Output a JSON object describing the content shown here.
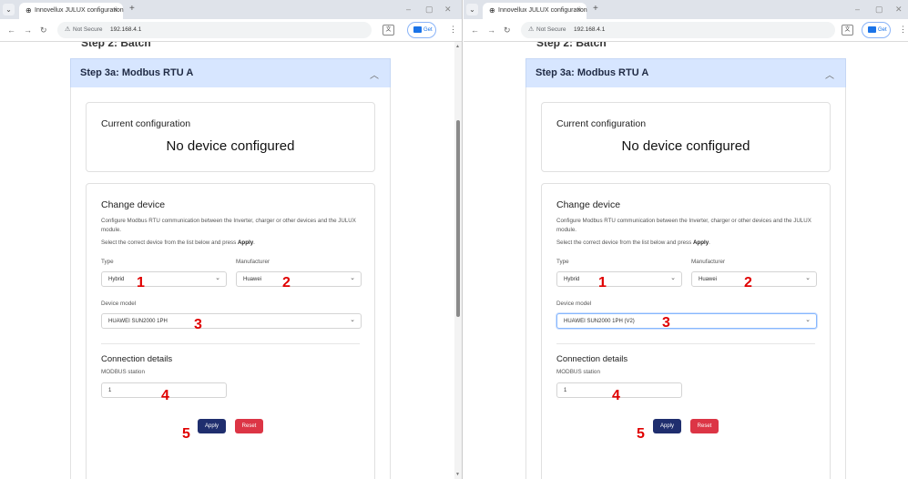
{
  "browser": {
    "tab_title": "Innovellux JULUX configuration",
    "tab_close": "×",
    "new_tab": "+",
    "not_secure": "Not Secure",
    "url": "192.168.4.1",
    "get_label": "Get",
    "warn_icon": "warning-icon"
  },
  "page": {
    "prev_step_label": "Step 2: Batch",
    "step_title": "Step 3a: Modbus RTU A",
    "current_config_title": "Current configuration",
    "current_config_value": "No device configured",
    "change_device_title": "Change device",
    "change_device_desc": "Configure Modbus RTU communication between the Inverter, charger or other devices and the JULUX module.",
    "instruction_prefix": "Select the correct device from the list below and press ",
    "instruction_bold": "Apply",
    "instruction_suffix": ".",
    "type_label": "Type",
    "manufacturer_label": "Manufacturer",
    "device_model_label": "Device model",
    "connection_title": "Connection details",
    "modbus_label": "MODBUS station",
    "apply_label": "Apply",
    "reset_label": "Reset"
  },
  "left": {
    "type_value": "Hybrid",
    "manufacturer_value": "Huawei",
    "device_model_value": "HUAWEI SUN2000 1PH",
    "modbus_value": "1"
  },
  "right": {
    "type_value": "Hybrid",
    "manufacturer_value": "Huawei",
    "device_model_value": "HUAWEI SUN2000 1PH (V2)",
    "modbus_value": "1"
  },
  "annotations": [
    "1",
    "2",
    "3",
    "4",
    "5"
  ],
  "colors": {
    "step_header_bg": "#d7e6ff",
    "apply_button": "#1f2e6e",
    "reset_button": "#dc3545",
    "annotation": "#e00000"
  }
}
